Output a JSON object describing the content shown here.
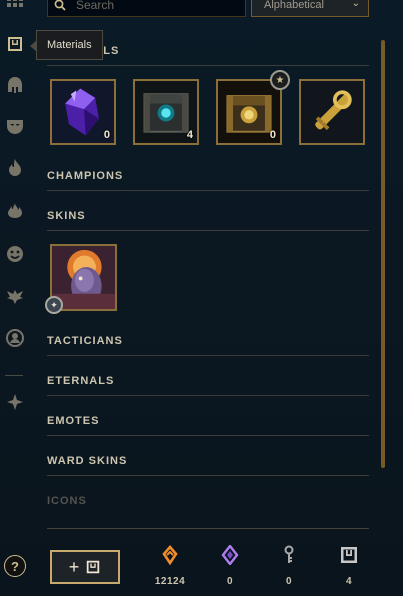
{
  "search": {
    "placeholder": "Search"
  },
  "sort": {
    "selected": "Alphabetical"
  },
  "tooltip": {
    "text": "Materials"
  },
  "rail": {
    "items": [
      {
        "name": "grid",
        "icon": "grid-icon"
      },
      {
        "name": "materials",
        "icon": "materials-chest-icon",
        "active": true
      },
      {
        "name": "champions",
        "icon": "helmet-icon"
      },
      {
        "name": "skins",
        "icon": "mask-icon"
      },
      {
        "name": "eternals",
        "icon": "flame-icon"
      },
      {
        "name": "ward-skins",
        "icon": "fire-icon"
      },
      {
        "name": "emotes",
        "icon": "smiley-icon"
      },
      {
        "name": "tacticians",
        "icon": "winged-icon"
      },
      {
        "name": "profile",
        "icon": "profile-icon"
      },
      {
        "name": "tft",
        "icon": "tft-icon"
      }
    ],
    "help": "?"
  },
  "sections": {
    "materials": "MATERIALS",
    "champions": "CHAMPIONS",
    "skins": "SKINS",
    "tacticians": "TACTICIANS",
    "eternals": "ETERNALS",
    "emotes": "EMOTES",
    "ward_skins": "WARD SKINS",
    "icons": "ICONS"
  },
  "materials": [
    {
      "name": "gemstone",
      "icon": "purple-gem-icon",
      "count": "0"
    },
    {
      "name": "hextech-chest",
      "icon": "hextech-chest-icon",
      "count": "4"
    },
    {
      "name": "masterwork-chest",
      "icon": "masterwork-chest-icon",
      "count": "0"
    },
    {
      "name": "hextech-key",
      "icon": "golden-key-icon",
      "count": ""
    }
  ],
  "skins": [
    {
      "name": "skin-tile",
      "icon": "champion-skin-portrait"
    }
  ],
  "currencies": [
    {
      "name": "blue-essence",
      "icon": "blue-essence-icon",
      "value": "12124",
      "color": "#f08c2a"
    },
    {
      "name": "mythic-essence",
      "icon": "mythic-essence-icon",
      "value": "0",
      "color": "#b07cf0"
    },
    {
      "name": "key-fragment",
      "icon": "key-fragment-icon",
      "value": "0",
      "color": "#a9a9a9"
    },
    {
      "name": "chests",
      "icon": "chest-icon",
      "value": "4",
      "color": "#c7c7c7"
    }
  ],
  "craft": {
    "label": "+"
  },
  "colors": {
    "gold": "#c8aa6e",
    "border": "#785a28",
    "bg": "#0a1a26"
  }
}
